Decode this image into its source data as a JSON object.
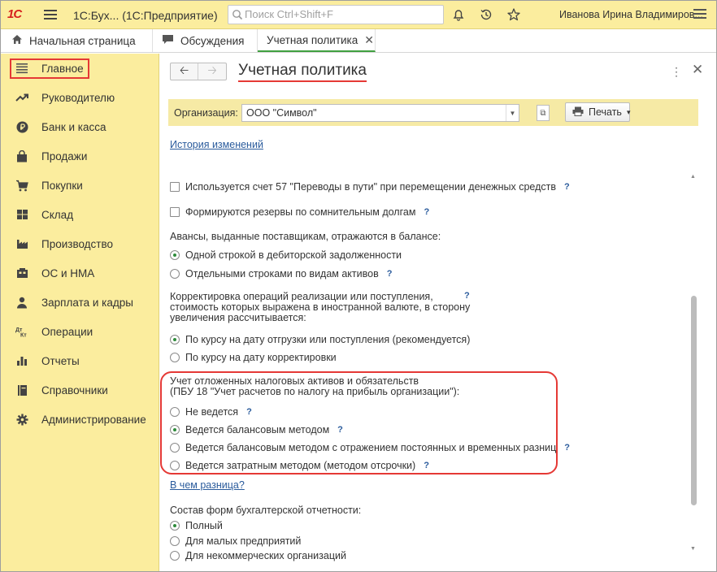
{
  "topbar": {
    "logo": "1С",
    "app_title": "1С:Бух...  (1С:Предприятие)",
    "search_placeholder": "Поиск Ctrl+Shift+F",
    "user_name": "Иванова Ирина Владимиров..."
  },
  "tabs": [
    {
      "label": "Начальная страница",
      "icon": "home-icon"
    },
    {
      "label": "Обсуждения",
      "icon": "chat-icon"
    },
    {
      "label": "Учетная политика",
      "close": "✕"
    }
  ],
  "sidebar": {
    "items": [
      {
        "label": "Главное",
        "icon": "list-icon"
      },
      {
        "label": "Руководителю",
        "icon": "trend-icon"
      },
      {
        "label": "Банк и касса",
        "icon": "ruble-icon"
      },
      {
        "label": "Продажи",
        "icon": "bag-icon"
      },
      {
        "label": "Покупки",
        "icon": "cart-icon"
      },
      {
        "label": "Склад",
        "icon": "warehouse-icon"
      },
      {
        "label": "Производство",
        "icon": "factory-icon"
      },
      {
        "label": "ОС и НМА",
        "icon": "assets-icon"
      },
      {
        "label": "Зарплата и кадры",
        "icon": "person-icon"
      },
      {
        "label": "Операции",
        "icon": "dt-kt-icon"
      },
      {
        "label": "Отчеты",
        "icon": "chart-icon"
      },
      {
        "label": "Справочники",
        "icon": "book-icon"
      },
      {
        "label": "Администрирование",
        "icon": "gear-icon"
      }
    ]
  },
  "form": {
    "title": "Учетная политика",
    "org_label": "Организация:",
    "org_value": "ООО \"Символ\"",
    "print_label": "Печать",
    "history_link": "История изменений",
    "check_57": "Используется счет 57 \"Переводы в пути\" при перемещении денежных средств",
    "check_reserves": "Формируются резервы по сомнительным долгам",
    "advances_heading": "Авансы, выданные поставщикам, отражаются в балансе:",
    "advances_opt1": "Одной строкой в дебиторской задолженности",
    "advances_opt2": "Отдельными строками по видам активов",
    "correction_line1": "Корректировка операций реализации или поступления,",
    "correction_line2": "стоимость которых выражена в иностранной валюте, в сторону",
    "correction_line3": "увеличения рассчитывается:",
    "correction_opt1": "По курсу на дату отгрузки или поступления (рекомендуется)",
    "correction_opt2": "По курсу на дату корректировки",
    "tax_line1": "Учет отложенных налоговых активов и обязательств",
    "tax_line2": "(ПБУ 18 \"Учет расчетов по налогу на прибыль организации\"):",
    "tax_opt1": "Не ведется",
    "tax_opt2": "Ведется балансовым методом",
    "tax_opt3": "Ведется балансовым методом с отражением постоянных и временных разниц",
    "tax_opt4": "Ведется затратным методом (методом отсрочки)",
    "difference_link": "В чем разница?",
    "reports_heading": "Состав форм бухгалтерской отчетности:",
    "reports_opt1": "Полный",
    "reports_opt2": "Для малых предприятий",
    "reports_opt3": "Для некоммерческих организаций",
    "help_mark": "?"
  }
}
